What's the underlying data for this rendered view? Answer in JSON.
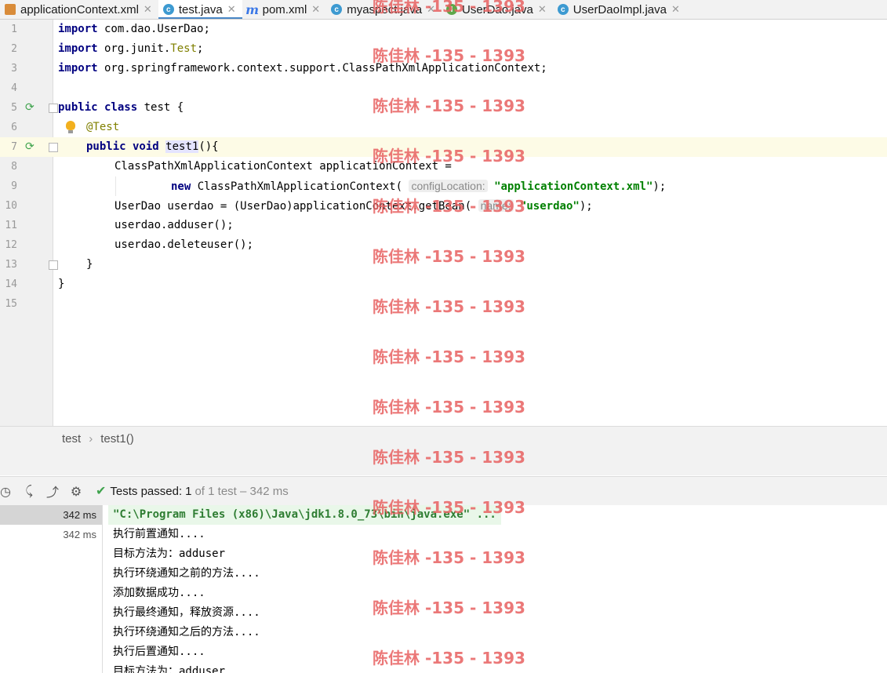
{
  "tabs": [
    {
      "label": "applicationContext.xml",
      "icon": "xml-file-icon",
      "active": false
    },
    {
      "label": "test.java",
      "icon": "java-class-icon",
      "active": true
    },
    {
      "label": "pom.xml",
      "icon": "maven-icon",
      "active": false
    },
    {
      "label": "myaspect.java",
      "icon": "java-class-icon",
      "active": false
    },
    {
      "label": "UserDao.java",
      "icon": "java-interface-icon",
      "active": false
    },
    {
      "label": "UserDaoImpl.java",
      "icon": "java-class-icon",
      "active": false
    }
  ],
  "editor": {
    "lines": [
      {
        "num": "1",
        "t1": "import",
        "t2": " com.dao.UserDao;"
      },
      {
        "num": "2",
        "t1": "import",
        "t2": " org.junit.",
        "t3": "Test",
        "t4": ";"
      },
      {
        "num": "3",
        "t1": "import",
        "t2": " org.springframework.context.support.ClassPathXmlApplicationContext;"
      },
      {
        "num": "4"
      },
      {
        "num": "5",
        "t1": "public class",
        "t2": " test {"
      },
      {
        "num": "6",
        "t1": "@Test"
      },
      {
        "num": "7",
        "t1": "public void",
        "t2": "test1",
        "t3": "(){"
      },
      {
        "num": "8",
        "t1": "ClassPathXmlApplicationContext applicationContext ="
      },
      {
        "num": "9",
        "t1": "new",
        "t2": " ClassPathXmlApplicationContext(",
        "hint": "configLocation:",
        "t3": "\"applicationContext.xml\"",
        "t4": ");"
      },
      {
        "num": "10",
        "t1": "UserDao userdao = (UserDao)applicationContext.getBean(",
        "hint": "name:",
        "t2": "\"userdao\"",
        "t3": ");"
      },
      {
        "num": "11",
        "t1": "userdao.adduser();"
      },
      {
        "num": "12",
        "t1": "userdao.deleteuser();"
      },
      {
        "num": "13",
        "t1": "}"
      },
      {
        "num": "14",
        "t1": "}"
      },
      {
        "num": "15"
      }
    ]
  },
  "breadcrumb": {
    "item1": "test",
    "sep": "›",
    "item2": "test1()"
  },
  "run": {
    "status_label": "Tests passed:",
    "passed_count": "1",
    "status_detail": "of 1 test – 342 ms"
  },
  "tree": {
    "rows": [
      "342 ms",
      "342 ms"
    ]
  },
  "console": {
    "lines": [
      "\"C:\\Program Files (x86)\\Java\\jdk1.8.0_73\\bin\\java.exe\" ...",
      "执行前置通知....",
      "目标方法为：adduser",
      "执行环绕通知之前的方法....",
      "添加数据成功....",
      "执行最终通知，释放资源....",
      "执行环绕通知之后的方法....",
      "执行后置通知....",
      "目标方法为：adduser"
    ]
  },
  "watermark": {
    "text": "陈佳林 -135 - 1393"
  },
  "colors": {
    "keyword": "#000080",
    "annotation": "#808000",
    "string": "#008000",
    "accent": "#4a88c7",
    "watermark": "#e86060"
  }
}
